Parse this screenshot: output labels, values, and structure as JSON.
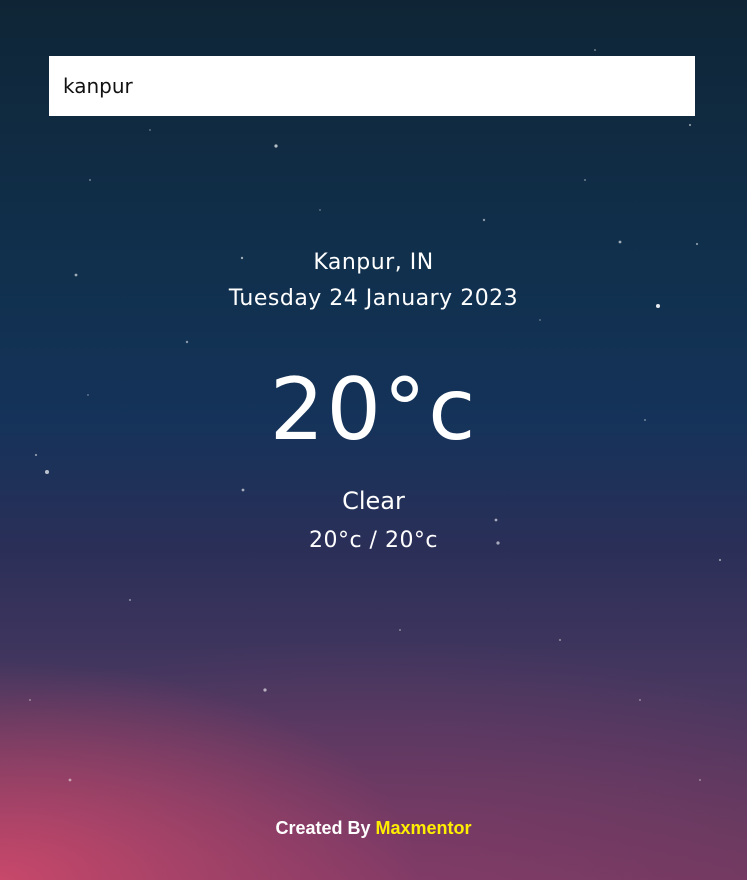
{
  "search": {
    "value": "kanpur"
  },
  "weather": {
    "location": "Kanpur, IN",
    "date": "Tuesday 24 January 2023",
    "temperature": "20°c",
    "condition": "Clear",
    "hi_low": "20°c / 20°c"
  },
  "footer": {
    "prefix": "Created By",
    "author": "Maxmentor"
  },
  "colors": {
    "author_accent": "#ffee00"
  }
}
